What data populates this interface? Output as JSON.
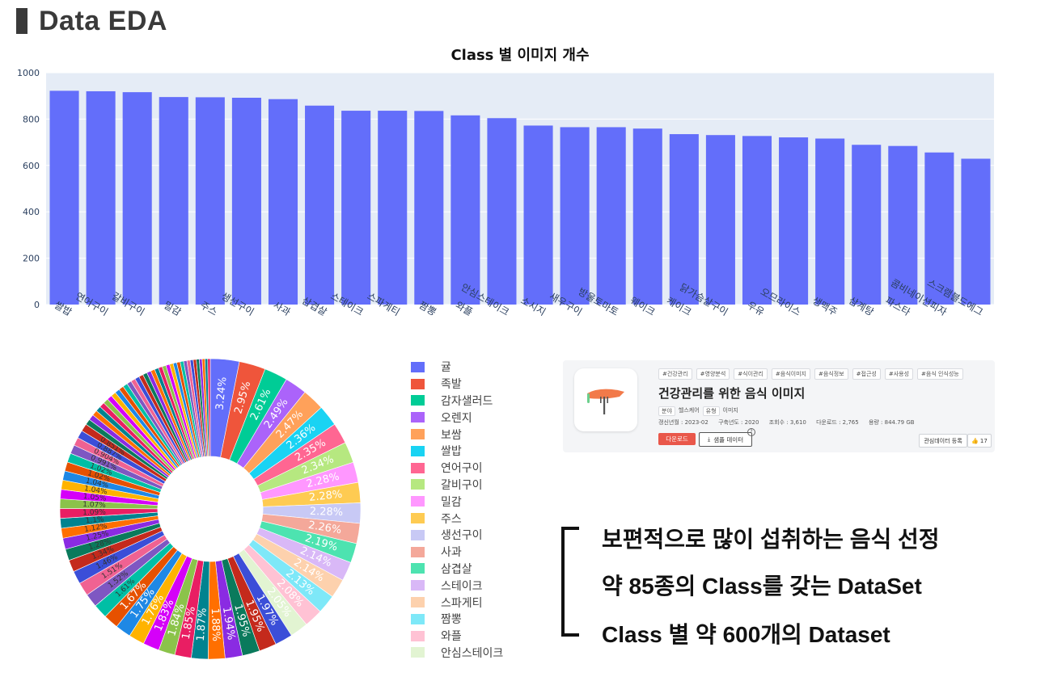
{
  "header": {
    "title": "Data EDA"
  },
  "colors": {
    "bar": "#636efa",
    "plot_bg": "#e5ecf6",
    "grid": "#ffffff"
  },
  "chart_data": [
    {
      "type": "bar",
      "title": "Class 별 이미지 개수",
      "xlabel": "",
      "ylabel": "",
      "ylim": [
        0,
        1000
      ],
      "yticks": [
        0,
        200,
        400,
        600,
        800,
        1000
      ],
      "grid": true,
      "categories": [
        "쌀밥",
        "연어구이",
        "갈비구이",
        "밀감",
        "주스",
        "생선구이",
        "사과",
        "삼겹살",
        "스테이크",
        "스파게티",
        "짬뽕",
        "와플",
        "안심스테이크",
        "소시지",
        "새우구이",
        "방울토마토",
        "웨이크",
        "케이크",
        "닭가슴살구이",
        "우유",
        "오므라이스",
        "생맥주",
        "삼계탕",
        "파스타",
        "콤비네이션피자",
        "스크램블드에그"
      ],
      "values": [
        922,
        920,
        916,
        895,
        894,
        892,
        886,
        858,
        836,
        836,
        835,
        816,
        804,
        772,
        765,
        765,
        759,
        735,
        731,
        727,
        721,
        716,
        689,
        684,
        656,
        629
      ]
    },
    {
      "type": "pie",
      "hole": 0.35,
      "labels": [
        "귤",
        "족발",
        "감자샐러드",
        "오렌지",
        "보쌈",
        "쌀밥",
        "연어구이",
        "갈비구이",
        "밀감",
        "주스",
        "생선구이",
        "사과",
        "삼겹살",
        "스테이크",
        "스파게티",
        "짬뽕",
        "와플",
        "안심스테이크"
      ],
      "colors": [
        "#636efa",
        "#ef553b",
        "#00cc96",
        "#ab63fa",
        "#ffa15a",
        "#19d3f3",
        "#ff6692",
        "#b6e880",
        "#ff97ff",
        "#fecb52",
        "#c8c9f5",
        "#f4a89a",
        "#4de3b0",
        "#d9b8f7",
        "#fdd1ad",
        "#7ee8f8",
        "#ffc2d4",
        "#e2f4d2"
      ],
      "series": [
        {
          "values": [
            3.24,
            2.95,
            2.61,
            2.49,
            2.47,
            2.36,
            2.35,
            2.34,
            2.28,
            2.28,
            2.28,
            2.26,
            2.19,
            2.14,
            2.14,
            2.13,
            2.08,
            2.05,
            1.97,
            1.95,
            1.95,
            1.94,
            1.88,
            1.87,
            1.85,
            1.84,
            1.83,
            1.76,
            1.75,
            1.67,
            1.61,
            1.52,
            1.51,
            1.46,
            1.34,
            1.28,
            1.25,
            1.12,
            1.1,
            1.09,
            1.07,
            1.05,
            1.04,
            1.04,
            1.02,
            1.02,
            0.991,
            0.904,
            0.887,
            0.851,
            0.646,
            0.631,
            0.609,
            0.6,
            0.59,
            0.58,
            0.57,
            0.56,
            0.55,
            0.54,
            0.53,
            0.52,
            0.51,
            0.5,
            0.49,
            0.48,
            0.47,
            0.46,
            0.45,
            0.44,
            0.43,
            0.42,
            0.41,
            0.4,
            0.39,
            0.38,
            0.37,
            0.36,
            0.35,
            0.34,
            0.33,
            0.32,
            0.31,
            0.3,
            0.29
          ]
        }
      ],
      "shown_labels": [
        "3.24%",
        "2.95%",
        "2.61%",
        "2.49%",
        "2.47%",
        "2.36%",
        "2.35%",
        "2.34%",
        "2.28%",
        "2.28%",
        "2.28%",
        "2.26%",
        "2.19%",
        "2.14%",
        "2.14%",
        "2.13%",
        "2.08%",
        "2.05%",
        "1.97%",
        "1.95%",
        "1.95%",
        "1.94%",
        "1.88%",
        "1.87%",
        "1.85%",
        "1.84%",
        "1.83%",
        "1.76%",
        "1.75%",
        "1.67%",
        "1.61%",
        "1.52%",
        "1.51%",
        "1.46%",
        "1.34%",
        "1.28%",
        "1.25%",
        "1.12%",
        "1.1%",
        "1.09%",
        "1.07%",
        "1.05%",
        "1.04%",
        "1.04%",
        "1.02%",
        "1.02%",
        "0.991%",
        "0.904%",
        "0.887%",
        "0.851%"
      ]
    }
  ],
  "dataset_card": {
    "tags": [
      "#건강관리",
      "#영양분석",
      "#식이관리",
      "#음식이미지",
      "#음식정보",
      "#접근성",
      "#사용성",
      "#음식 인식성능"
    ],
    "title": "건강관리를 위한 음식 이미지",
    "field_key": "분야",
    "field_value": "헬스케어",
    "type_key": "유형",
    "type_value": "이미지",
    "updated": "갱신년월 : 2023-02",
    "built_year": "구축년도 : 2020",
    "views": "조회수 : 3,610",
    "downloads": "다운로드 : 2,765",
    "size": "용량 : 844.79 GB",
    "download_button": "다운로드",
    "sample_button": "샘플 데이터",
    "help": "?",
    "favorite_button": "관심데이터 등록",
    "likes": "17"
  },
  "summary": {
    "line1": "보편적으로 많이 섭취하는 음식 선정",
    "line2": "약 85종의 Class를 갖는 DataSet",
    "line3": "Class 별 약 600개의 Dataset"
  }
}
